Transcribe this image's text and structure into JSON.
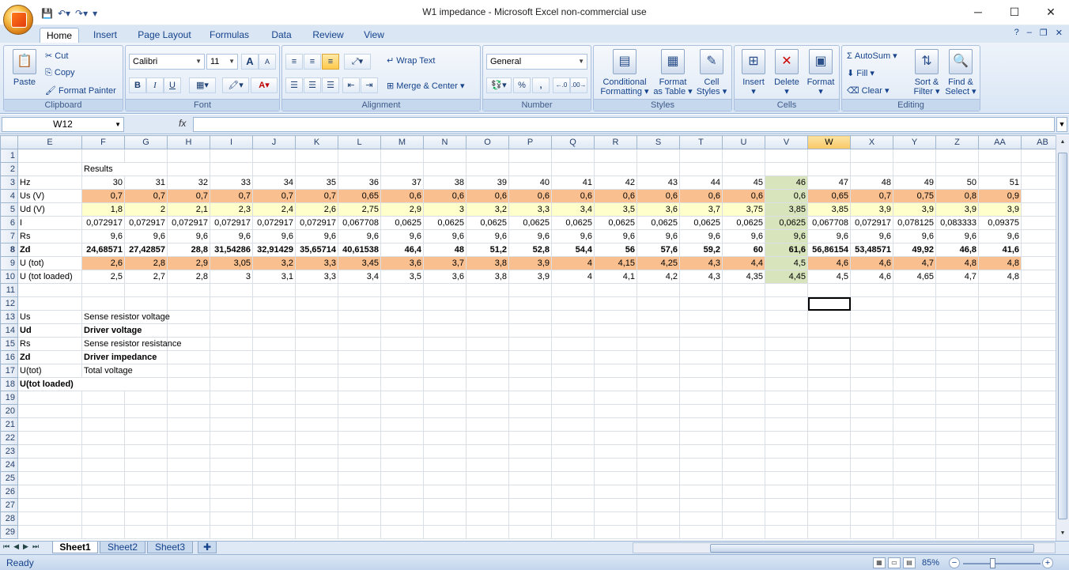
{
  "window": {
    "title": "W1 impedance - Microsoft Excel non-commercial use",
    "minimize": "─",
    "maximize": "☐",
    "close": "✕"
  },
  "qat": {
    "save": "💾",
    "undo": "↶▾",
    "redo": "↷▾",
    "customize": "▾"
  },
  "tabs": [
    "Home",
    "Insert",
    "Page Layout",
    "Formulas",
    "Data",
    "Review",
    "View"
  ],
  "ribbon_right": {
    "help": "?",
    "min": "–",
    "restore": "❐",
    "close": "✕"
  },
  "ribbon": {
    "clipboard": {
      "label": "Clipboard",
      "paste": "Paste",
      "cut": "Cut",
      "copy": "Copy",
      "format_painter": "Format Painter"
    },
    "font": {
      "label": "Font",
      "family": "Calibri",
      "size": "11",
      "grow": "A",
      "shrink": "A",
      "bold": "B",
      "italic": "I",
      "underline": "U"
    },
    "alignment": {
      "label": "Alignment",
      "wrap": "Wrap Text",
      "merge": "Merge & Center"
    },
    "number": {
      "label": "Number",
      "format": "General",
      "percent": "%",
      "comma": ","
    },
    "styles": {
      "label": "Styles",
      "conditional": [
        "Conditional",
        "Formatting"
      ],
      "format_table": [
        "Format",
        "as Table"
      ],
      "cell_styles": [
        "Cell",
        "Styles"
      ]
    },
    "cells": {
      "label": "Cells",
      "insert": "Insert",
      "delete": "Delete",
      "format": "Format"
    },
    "editing": {
      "label": "Editing",
      "autosum": "AutoSum",
      "fill": "Fill",
      "clear": "Clear",
      "sort": [
        "Sort &",
        "Filter"
      ],
      "find": [
        "Find &",
        "Select"
      ]
    }
  },
  "formula_bar": {
    "name_box": "W12",
    "fx": "fx",
    "value": ""
  },
  "columns": [
    "E",
    "F",
    "G",
    "H",
    "I",
    "J",
    "K",
    "L",
    "M",
    "N",
    "O",
    "P",
    "Q",
    "R",
    "S",
    "T",
    "U",
    "V",
    "W",
    "X",
    "Y",
    "Z",
    "AA",
    "AB"
  ],
  "rows": {
    "r1": [],
    "r2": [
      "",
      "Results"
    ],
    "r3": [
      "Hz",
      "30",
      "31",
      "32",
      "33",
      "34",
      "35",
      "36",
      "37",
      "38",
      "39",
      "40",
      "41",
      "42",
      "43",
      "44",
      "45",
      "46",
      "47",
      "48",
      "49",
      "50",
      "51"
    ],
    "r4": [
      "Us (V)",
      "0,7",
      "0,7",
      "0,7",
      "0,7",
      "0,7",
      "0,7",
      "0,65",
      "0,6",
      "0,6",
      "0,6",
      "0,6",
      "0,6",
      "0,6",
      "0,6",
      "0,6",
      "0,6",
      "0,6",
      "0,65",
      "0,7",
      "0,75",
      "0,8",
      "0,9"
    ],
    "r5": [
      "Ud (V)",
      "1,8",
      "2",
      "2,1",
      "2,3",
      "2,4",
      "2,6",
      "2,75",
      "2,9",
      "3",
      "3,2",
      "3,3",
      "3,4",
      "3,5",
      "3,6",
      "3,7",
      "3,75",
      "3,85",
      "3,85",
      "3,9",
      "3,9",
      "3,9",
      "3,9"
    ],
    "r6": [
      "I",
      "0,072917",
      "0,072917",
      "0,072917",
      "0,072917",
      "0,072917",
      "0,072917",
      "0,067708",
      "0,0625",
      "0,0625",
      "0,0625",
      "0,0625",
      "0,0625",
      "0,0625",
      "0,0625",
      "0,0625",
      "0,0625",
      "0,0625",
      "0,067708",
      "0,072917",
      "0,078125",
      "0,083333",
      "0,09375"
    ],
    "r7": [
      "Rs",
      "9,6",
      "9,6",
      "9,6",
      "9,6",
      "9,6",
      "9,6",
      "9,6",
      "9,6",
      "9,6",
      "9,6",
      "9,6",
      "9,6",
      "9,6",
      "9,6",
      "9,6",
      "9,6",
      "9,6",
      "9,6",
      "9,6",
      "9,6",
      "9,6",
      "9,6"
    ],
    "r8": [
      "Zd",
      "24,68571",
      "27,42857",
      "28,8",
      "31,54286",
      "32,91429",
      "35,65714",
      "40,61538",
      "46,4",
      "48",
      "51,2",
      "52,8",
      "54,4",
      "56",
      "57,6",
      "59,2",
      "60",
      "61,6",
      "56,86154",
      "53,48571",
      "49,92",
      "46,8",
      "41,6"
    ],
    "r9": [
      "U (tot)",
      "2,6",
      "2,8",
      "2,9",
      "3,05",
      "3,2",
      "3,3",
      "3,45",
      "3,6",
      "3,7",
      "3,8",
      "3,9",
      "4",
      "4,15",
      "4,25",
      "4,3",
      "4,4",
      "4,5",
      "4,6",
      "4,6",
      "4,7",
      "4,8",
      "4,8"
    ],
    "r10": [
      "U (tot loaded)",
      "2,5",
      "2,7",
      "2,8",
      "3",
      "3,1",
      "3,3",
      "3,4",
      "3,5",
      "3,6",
      "3,8",
      "3,9",
      "4",
      "4,1",
      "4,2",
      "4,3",
      "4,35",
      "4,45",
      "4,5",
      "4,6",
      "4,65",
      "4,7",
      "4,8"
    ],
    "r13": [
      "Us",
      "Sense resistor voltage"
    ],
    "r14": [
      "Ud",
      "Driver voltage"
    ],
    "r15": [
      "Rs",
      "Sense resistor resistance"
    ],
    "r16": [
      "Zd",
      "Driver impedance"
    ],
    "r17": [
      "U(tot)",
      "Total voltage"
    ],
    "r18": [
      "U(tot loaded)",
      ""
    ]
  },
  "sheets": [
    "Sheet1",
    "Sheet2",
    "Sheet3"
  ],
  "status": {
    "ready": "Ready",
    "zoom": "85%"
  },
  "colors": {
    "orange_fill": "#f9bf8f",
    "yellow_fill": "#ffffcc",
    "green_fill": "#d8e4bc"
  }
}
